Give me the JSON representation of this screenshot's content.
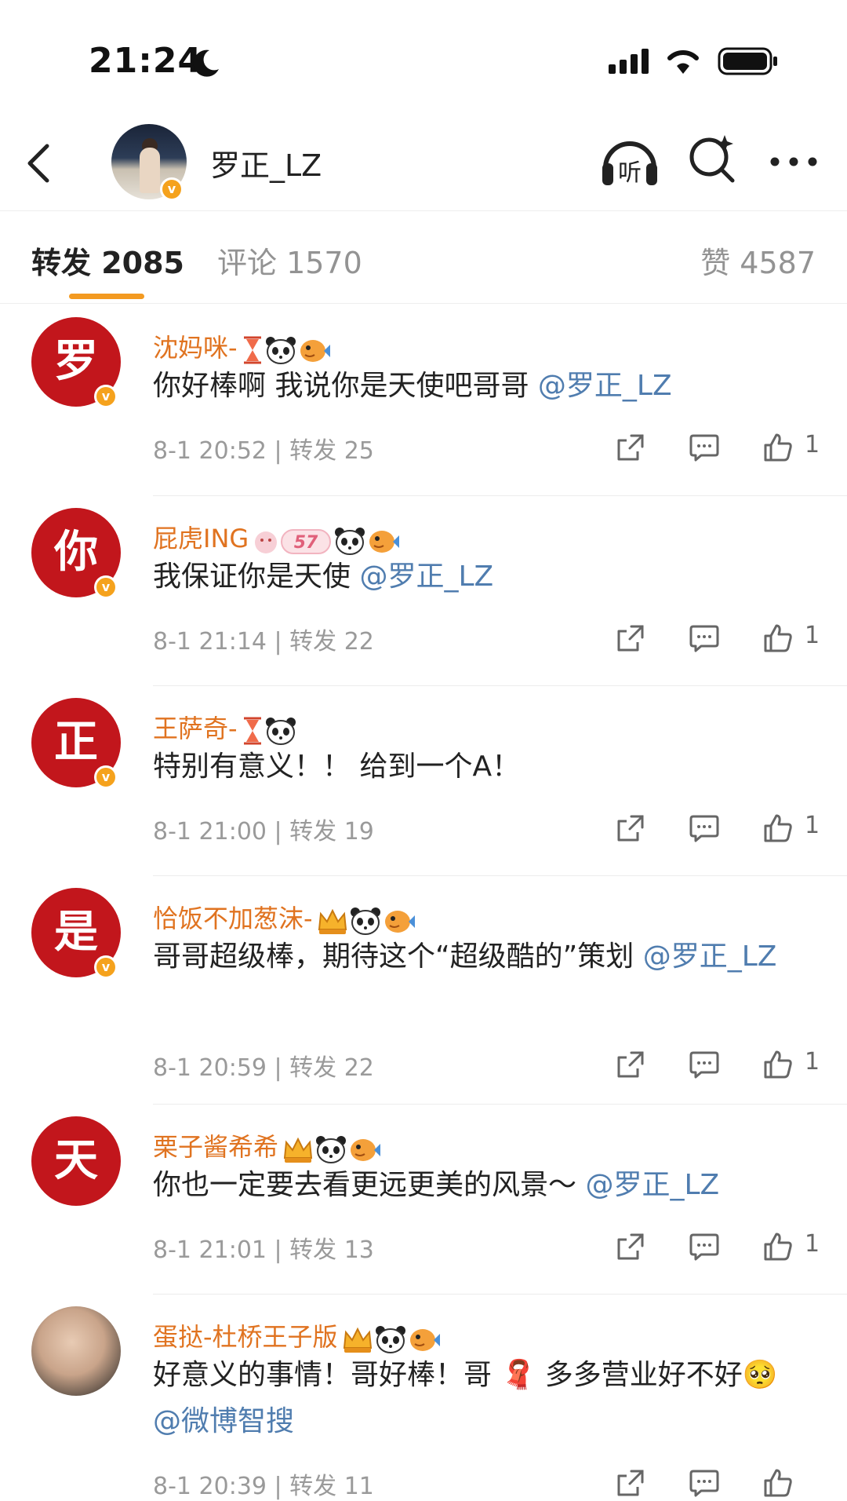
{
  "status_bar": {
    "time": "21:24"
  },
  "header": {
    "username": "罗正_LZ"
  },
  "tabs": {
    "forward": "转发 2085",
    "comment": "评论 1570",
    "like": "赞 4587"
  },
  "items": [
    {
      "avatar_char": "罗",
      "name": "沈妈咪-",
      "text_before": "你好棒啊 我说你是天使吧哥哥 ",
      "mention": "@罗正_LZ",
      "text_after": "",
      "meta": "8-1 20:52 | 转发 25",
      "likes": "1"
    },
    {
      "avatar_char": "你",
      "name": "屁虎ING",
      "text_before": "我保证你是天使 ",
      "mention": "@罗正_LZ",
      "text_after": "",
      "meta": "8-1 21:14 | 转发 22",
      "likes": "1"
    },
    {
      "avatar_char": "正",
      "name": "王萨奇-",
      "text_before": "特别有意义！！ 给到一个A！",
      "mention": "",
      "text_after": "",
      "meta": "8-1 21:00 | 转发 19",
      "likes": "1"
    },
    {
      "avatar_char": "是",
      "name": "恰饭不加葱沫-",
      "text_before": "哥哥超级棒，期待这个“超级酷的”策划 ",
      "mention": "@罗正_LZ",
      "text_after": "",
      "meta": "8-1 20:59 | 转发 22",
      "likes": "1"
    },
    {
      "avatar_char": "天",
      "name": "栗子酱希希",
      "text_before": "你也一定要去看更远更美的风景～ ",
      "mention": "@罗正_LZ",
      "text_after": "",
      "meta": "8-1 21:01 | 转发 13",
      "likes": "1"
    },
    {
      "avatar_char": "",
      "name": "蛋挞-杜桥王子版",
      "text_before": "好意义的事情！哥好棒！哥 🧣 多多营业好不好🥺 ",
      "mention": "@微博智搜",
      "text_after": "",
      "meta": "8-1 20:39 | 转发 11",
      "likes": ""
    }
  ],
  "badge_57": "57",
  "verify_mark": "v"
}
